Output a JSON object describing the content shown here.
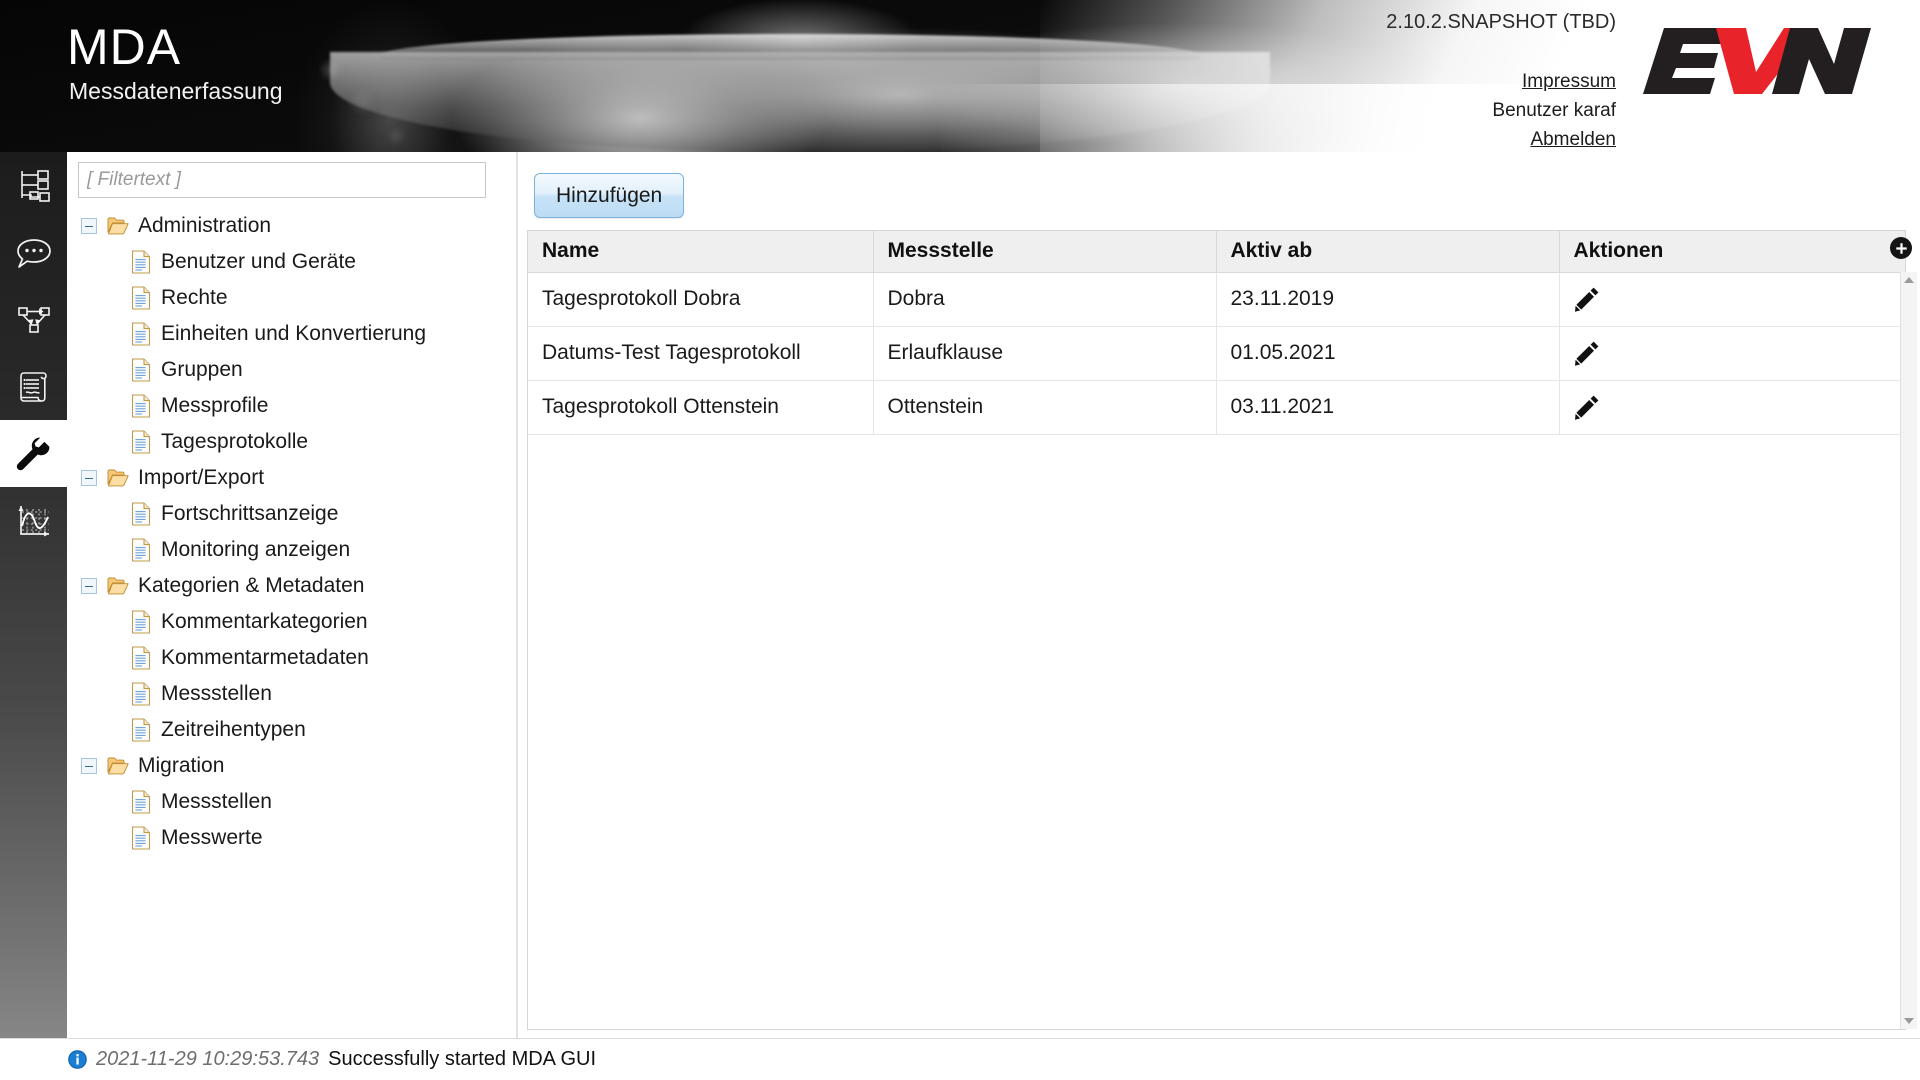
{
  "header": {
    "title": "MDA",
    "subtitle": "Messdatenerfassung",
    "version": "2.10.2.SNAPSHOT (TBD)",
    "links": {
      "impressum": "Impressum",
      "user": "Benutzer karaf",
      "logout": "Abmelden"
    },
    "logo": {
      "text": "EVN",
      "dark_color": "#231f20",
      "accent_color": "#e8232a"
    }
  },
  "icon_rail": {
    "items": [
      {
        "name": "hierarchy-tree-icon",
        "label": "Struktur",
        "active": false
      },
      {
        "name": "comment-bubble-icon",
        "label": "Kommentare",
        "active": false
      },
      {
        "name": "workflow-graph-icon",
        "label": "Workflow",
        "active": false
      },
      {
        "name": "scroll-document-icon",
        "label": "Protokolle",
        "active": false
      },
      {
        "name": "wrench-icon",
        "label": "Administration",
        "active": true
      },
      {
        "name": "chart-curve-icon",
        "label": "Auswertung",
        "active": false
      }
    ]
  },
  "tree_panel": {
    "filter_placeholder": "[ Filtertext ]",
    "filter_value": "",
    "nodes": [
      {
        "type": "folder",
        "label": "Administration",
        "expanded": true
      },
      {
        "type": "file",
        "label": "Benutzer und Geräte"
      },
      {
        "type": "file",
        "label": "Rechte"
      },
      {
        "type": "file",
        "label": "Einheiten und Konvertierung"
      },
      {
        "type": "file",
        "label": "Gruppen"
      },
      {
        "type": "file",
        "label": "Messprofile"
      },
      {
        "type": "file",
        "label": "Tagesprotokolle"
      },
      {
        "type": "folder",
        "label": "Import/Export",
        "expanded": true
      },
      {
        "type": "file",
        "label": "Fortschrittsanzeige"
      },
      {
        "type": "file",
        "label": "Monitoring anzeigen"
      },
      {
        "type": "folder",
        "label": "Kategorien & Metadaten",
        "expanded": true
      },
      {
        "type": "file",
        "label": "Kommentarkategorien"
      },
      {
        "type": "file",
        "label": "Kommentarmetadaten"
      },
      {
        "type": "file",
        "label": "Messstellen"
      },
      {
        "type": "file",
        "label": "Zeitreihentypen"
      },
      {
        "type": "folder",
        "label": "Migration",
        "expanded": true
      },
      {
        "type": "file",
        "label": "Messstellen"
      },
      {
        "type": "file",
        "label": "Messwerte"
      }
    ]
  },
  "content": {
    "add_button_label": "Hinzufügen",
    "table": {
      "columns": [
        "Name",
        "Messstelle",
        "Aktiv ab",
        "Aktionen"
      ],
      "rows": [
        {
          "name": "Tagesprotokoll Dobra",
          "messstelle": "Dobra",
          "aktiv_ab": "23.11.2019",
          "action": "edit-pencil-icon"
        },
        {
          "name": "Datums-Test Tagesprotokoll",
          "messstelle": "Erlaufklause",
          "aktiv_ab": "01.05.2021",
          "action": "edit-pencil-icon"
        },
        {
          "name": "Tagesprotokoll Ottenstein",
          "messstelle": "Ottenstein",
          "aktiv_ab": "03.11.2021",
          "action": "edit-pencil-icon"
        }
      ]
    },
    "column_config_button": "+"
  },
  "statusbar": {
    "icon": "info-icon",
    "timestamp": "2021-11-29 10:29:53.743",
    "message": "Successfully started MDA GUI"
  }
}
